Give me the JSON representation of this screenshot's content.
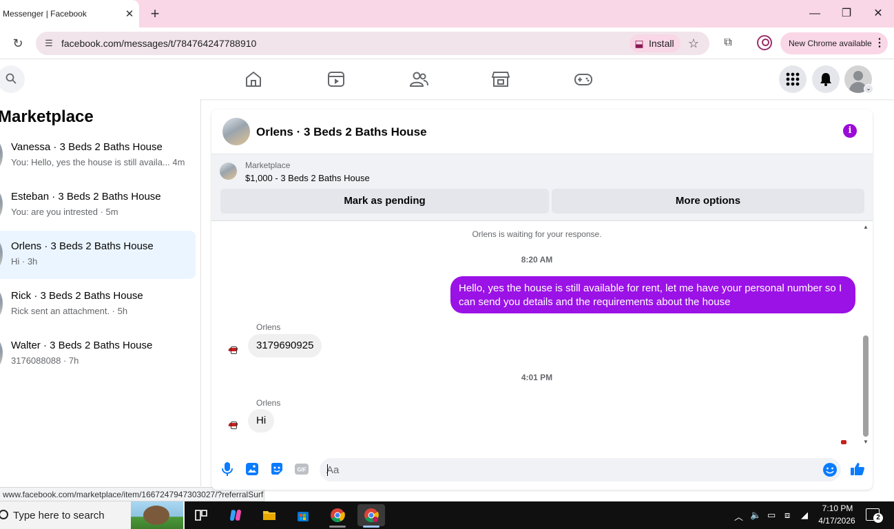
{
  "browser": {
    "tab_title": "Messenger | Facebook",
    "tab_close": "✕",
    "new_tab": "+",
    "url": "facebook.com/messages/t/784764247788910",
    "install_label": "Install",
    "new_chrome_label": "New Chrome available",
    "window_buttons": {
      "minimize": "—",
      "restore": "❐",
      "close": "✕"
    }
  },
  "sidebar": {
    "title": "Marketplace",
    "conversations": [
      {
        "name": "Vanessa · 3 Beds 2 Baths House",
        "preview": "You: Hello, yes the house is still availa... 4m",
        "active": false
      },
      {
        "name": "Esteban · 3 Beds 2 Baths House",
        "preview": "You: are you intrested · 5m",
        "active": false
      },
      {
        "name": "Orlens · 3 Beds 2 Baths House",
        "preview": "Hi · 3h",
        "active": true
      },
      {
        "name": "Rick · 3 Beds 2 Baths House",
        "preview": "Rick sent an attachment. · 5h",
        "active": false
      },
      {
        "name": "Walter · 3 Beds 2 Baths House",
        "preview": "3176088088 · 7h",
        "active": false
      }
    ]
  },
  "status_link": "www.facebook.com/marketplace/item/1667247947303027/?referralSurfac...",
  "chat": {
    "title": "Orlens · 3 Beds 2 Baths House",
    "listing": {
      "source": "Marketplace",
      "title": "$1,000 - 3 Beds 2 Baths House",
      "mark_pending": "Mark as pending",
      "more_options": "More options"
    },
    "waiting_note": "Orlens is waiting for your response.",
    "time_1": "8:20 AM",
    "outgoing_message": "Hello, yes the house is still available for rent, let me have your personal number so I can send you details and the requirements about the house",
    "sender_1": "Orlens",
    "incoming_1": "3179690925",
    "time_2": "4:01 PM",
    "sender_2": "Orlens",
    "incoming_2": "Hi",
    "composer_placeholder": "Aa"
  },
  "taskbar": {
    "search_placeholder": "Type here to search",
    "time": "7:10 PM",
    "date": "4/17/2026",
    "notification_count": "2"
  },
  "colors": {
    "accent_purple": "#9b12e6",
    "messenger_blue": "#0a7cff",
    "tab_strip_pink": "#f9d7e7"
  }
}
